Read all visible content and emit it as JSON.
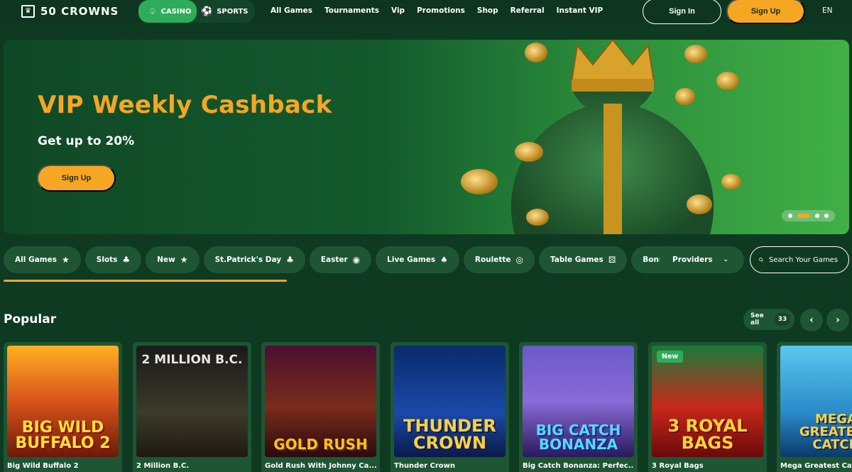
{
  "brand": {
    "logo_text": "50 CROWNS",
    "logo_icon": "crown-icon"
  },
  "mode_switch": [
    {
      "label": "CASINO",
      "icon": "spade-icon",
      "active": true
    },
    {
      "label": "SPORTS",
      "icon": "soccer-ball-icon",
      "active": false
    }
  ],
  "nav": [
    "All Games",
    "Tournaments",
    "Vip",
    "Promotions",
    "Shop",
    "Referral",
    "Instant VIP"
  ],
  "auth": {
    "signin_label": "Sign In",
    "signup_label": "Sign Up"
  },
  "language": "EN",
  "banner": {
    "title": "VIP Weekly Cashback",
    "subtitle": "Get up to 20%",
    "button_label": "Sign Up",
    "slide_count": 4,
    "active_slide": 2
  },
  "categories": [
    {
      "label": "All Games",
      "icon": "star-icon",
      "glyph": "★"
    },
    {
      "label": "Slots",
      "icon": "cherries-icon",
      "glyph": "🍒"
    },
    {
      "label": "New",
      "icon": "star-icon",
      "glyph": "★"
    },
    {
      "label": "St.Patrick's Day",
      "icon": "clover-icon",
      "glyph": "♣"
    },
    {
      "label": "Easter",
      "icon": "easter-egg-icon",
      "glyph": "◉"
    },
    {
      "label": "Live Games",
      "icon": "spade-icon",
      "glyph": "♠"
    },
    {
      "label": "Roulette",
      "icon": "roulette-icon",
      "glyph": "◎"
    },
    {
      "label": "Table Games",
      "icon": "dice-icon",
      "glyph": "⚄"
    },
    {
      "label": "Bonus Buy",
      "icon": "",
      "glyph": ""
    }
  ],
  "providers": {
    "label": "Providers"
  },
  "search": {
    "placeholder": "Search Your Games"
  },
  "popular": {
    "title": "Popular",
    "see_all_label": "See all",
    "count": "33",
    "games": [
      {
        "name": "Big Wild Buffalo 2",
        "art": "BIG WILD BUFFALO 2",
        "badge": ""
      },
      {
        "name": "2 Million B.C.",
        "art": "2 MILLION B.C.",
        "badge": ""
      },
      {
        "name": "Gold Rush With Johnny Ca...",
        "art": "GOLD RUSH",
        "badge": ""
      },
      {
        "name": "Thunder Crown",
        "art": "THUNDER CROWN",
        "badge": ""
      },
      {
        "name": "Big Catch Bonanza: Perfec...",
        "art": "BIG CATCH BONANZA",
        "badge": ""
      },
      {
        "name": "3 Royal Bags",
        "art": "3 ROYAL BAGS",
        "badge": "New"
      },
      {
        "name": "Mega Greatest Ca...",
        "art": "MEGA GREATEST CATCH",
        "badge": ""
      }
    ]
  },
  "colors": {
    "accent": "#f5a623",
    "green_active": "#2eac5a",
    "bg": "#0f3a22",
    "pill": "#1e5634"
  }
}
